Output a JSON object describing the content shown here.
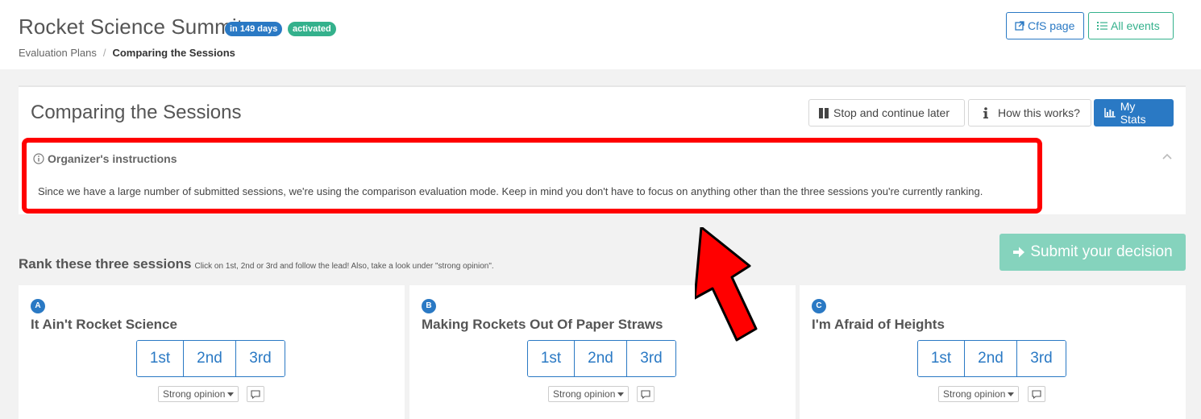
{
  "header": {
    "event_title": "Rocket Science Summit",
    "badge_days": "in 149 days",
    "badge_status": "activated",
    "breadcrumb": {
      "parent": "Evaluation Plans",
      "separator": "/",
      "current": "Comparing the Sessions"
    },
    "buttons": {
      "cfs_page": "CfS page",
      "all_events": "All events"
    }
  },
  "panel": {
    "title": "Comparing the Sessions",
    "buttons": {
      "stop": "Stop and continue later",
      "how": "How this works?",
      "stats": "My Stats"
    },
    "instructions": {
      "heading": "Organizer's instructions",
      "text": "Since we have a large number of submitted sessions, we're using the comparison evaluation mode. Keep in mind you don't have to focus on anything other than the three sessions you're currently ranking."
    }
  },
  "ranking": {
    "title": "Rank these three sessions",
    "hint": "Click on 1st, 2nd or 3rd and follow the lead! Also, take a look under \"strong opinion\".",
    "submit_label": "Submit your decision",
    "rank_labels": [
      "1st",
      "2nd",
      "3rd"
    ],
    "opinion_label": "Strong opinion",
    "sessions": [
      {
        "letter": "A",
        "title": "It Ain't Rocket Science"
      },
      {
        "letter": "B",
        "title": "Making Rockets Out Of Paper Straws"
      },
      {
        "letter": "C",
        "title": "I'm Afraid of Heights"
      }
    ]
  },
  "colors": {
    "primary": "#2a79c4",
    "success": "#34b18c",
    "submit_disabled": "#85d3bd",
    "highlight": "#ff0000"
  }
}
